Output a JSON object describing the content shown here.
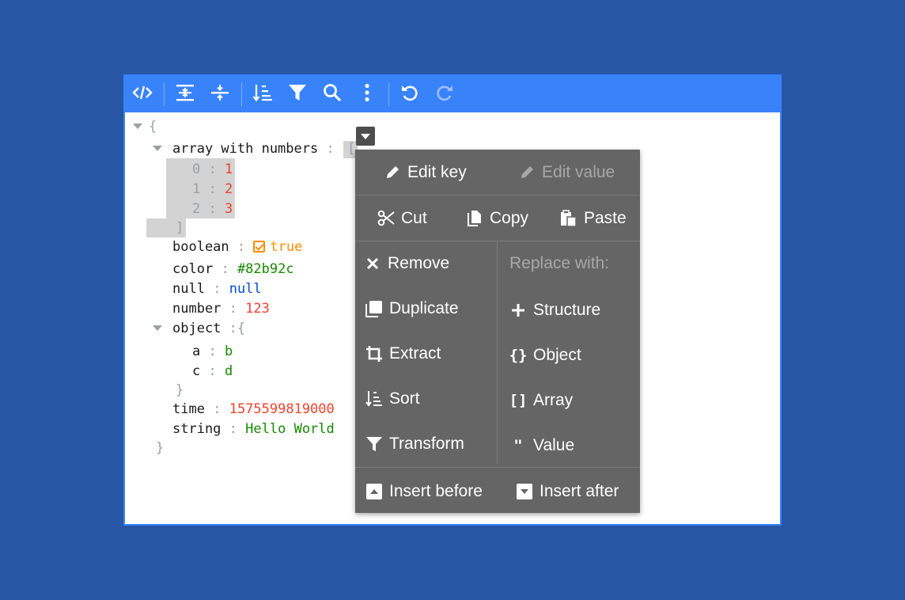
{
  "toolbar": {
    "buttons": [
      {
        "name": "code-mode",
        "icon": "code-icon"
      },
      {
        "name": "expand-all",
        "icon": "expand-all-icon"
      },
      {
        "name": "collapse-all",
        "icon": "collapse-all-icon"
      },
      {
        "name": "sort",
        "icon": "sort-icon"
      },
      {
        "name": "filter",
        "icon": "filter-icon"
      },
      {
        "name": "search",
        "icon": "search-icon"
      },
      {
        "name": "more",
        "icon": "more-vertical-icon"
      },
      {
        "name": "undo",
        "icon": "undo-icon"
      },
      {
        "name": "redo",
        "icon": "redo-icon"
      }
    ]
  },
  "tree": {
    "root_open": "{",
    "root_close": "}",
    "array": {
      "key": "array with numbers",
      "open": "[",
      "close": "]",
      "items": [
        {
          "index": "0",
          "value": "1"
        },
        {
          "index": "1",
          "value": "2"
        },
        {
          "index": "2",
          "value": "3"
        }
      ]
    },
    "boolean": {
      "key": "boolean",
      "value": "true"
    },
    "color": {
      "key": "color",
      "value": "#82b92c"
    },
    "null": {
      "key": "null",
      "value": "null"
    },
    "number": {
      "key": "number",
      "value": "123"
    },
    "object": {
      "key": "object",
      "open": "{",
      "close": "}",
      "items": [
        {
          "key": "a",
          "value": "b"
        },
        {
          "key": "c",
          "value": "d"
        }
      ]
    },
    "time": {
      "key": "time",
      "value": "1575599819000"
    },
    "string": {
      "key": "string",
      "value": "Hello World"
    },
    "separator": ":"
  },
  "context_menu": {
    "edit_key": "Edit key",
    "edit_value": "Edit value",
    "cut": "Cut",
    "copy": "Copy",
    "paste": "Paste",
    "remove": "Remove",
    "duplicate": "Duplicate",
    "extract": "Extract",
    "sort": "Sort",
    "transform": "Transform",
    "replace_with": "Replace with:",
    "structure": "Structure",
    "object": "Object",
    "array": "Array",
    "value": "Value",
    "insert_before": "Insert before",
    "insert_after": "Insert after",
    "icon_object": "{}",
    "icon_array": "[]",
    "icon_value": "\""
  },
  "colors": {
    "background": "#2756a5",
    "toolbar": "#3883fa",
    "menu": "#656565",
    "number": "#ee422e",
    "string": "#148a00",
    "null": "#004ed0",
    "boolean": "#ff8c00"
  }
}
